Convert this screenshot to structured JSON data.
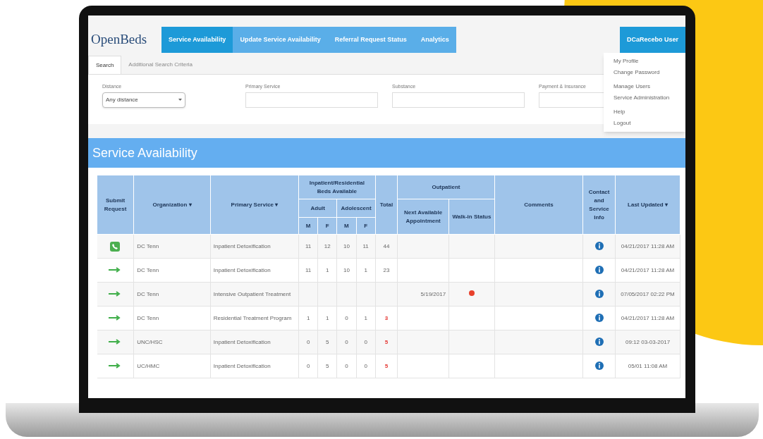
{
  "nav": {
    "logo": "OpenBeds",
    "tabs": [
      {
        "label": "Service Availability",
        "selected": true
      },
      {
        "label": "Update Service Availability",
        "selected": false
      },
      {
        "label": "Referral Request Status",
        "selected": false
      },
      {
        "label": "Analytics",
        "selected": false
      }
    ],
    "user": "DCaRecebo User"
  },
  "user_menu": {
    "groups": [
      [
        "My Profile",
        "Change Password"
      ],
      [
        "Manage Users",
        "Service Administration"
      ],
      [
        "Help",
        "Logout"
      ]
    ]
  },
  "search_tabs": [
    {
      "label": "Search",
      "selected": true
    },
    {
      "label": "Additional Search Criteria",
      "selected": false
    }
  ],
  "filters": [
    {
      "label": "Distance",
      "kind": "select",
      "value": "Any distance"
    },
    {
      "label": "Primary Service",
      "kind": "text"
    },
    {
      "label": "Substance",
      "kind": "text"
    },
    {
      "label": "Payment & Insurance",
      "kind": "text"
    }
  ],
  "section_title": "Service Availability",
  "table": {
    "headers": {
      "submit": "Submit Request",
      "organization": "Organization ▾",
      "service": "Primary Service ▾",
      "beds": "Inpatient/Residential Beds Available",
      "adult": "Adult",
      "adolescent": "Adolescent",
      "m": "M",
      "f": "F",
      "m2": "M",
      "f2": "F",
      "total": "Total",
      "outpatient": "Outpatient",
      "next": "Next Available Appointment",
      "walkin": "Walk-in Status",
      "comments": "Comments",
      "contact": "Contact and Service Info",
      "updated": "Last Updated ▾"
    },
    "rows": [
      {
        "kind": "phone",
        "organization": "DC Tenn",
        "service": "Inpatient Detoxification",
        "beds": [
          "11",
          "12",
          "10",
          "11"
        ],
        "total": "44",
        "total_alert": false,
        "next": "",
        "walkin": null,
        "updated": "04/21/2017 11:28 AM"
      },
      {
        "kind": "arrow",
        "organization": "DC Tenn",
        "service": "Inpatient Detoxification",
        "beds": [
          "11",
          "1",
          "10",
          "1"
        ],
        "total": "23",
        "total_alert": false,
        "next": "",
        "walkin": null,
        "updated": "04/21/2017 11:28 AM"
      },
      {
        "kind": "arrow",
        "organization": "DC Tenn",
        "service": "Intensive Outpatient Treatment",
        "beds": [],
        "total": "",
        "next": "5/19/2017",
        "walkin": {
          "color": "#e8412c"
        },
        "updated": "07/05/2017 02:22 PM"
      },
      {
        "kind": "arrow",
        "organization": "DC Tenn",
        "service": "Residential Treatment Program",
        "beds": [
          "1",
          "1",
          "0",
          "1"
        ],
        "total": "3",
        "total_alert": true,
        "next": "",
        "walkin": null,
        "updated": "04/21/2017 11:28 AM"
      },
      {
        "kind": "arrow",
        "organization": "UNC/HSC",
        "service": "Inpatient Detoxification",
        "beds": [
          "0",
          "5",
          "0",
          "0"
        ],
        "total": "5",
        "total_alert": true,
        "next": "",
        "walkin": null,
        "updated": "09:12 03-03-2017"
      },
      {
        "kind": "arrow",
        "organization": "UC/HMC",
        "service": "Inpatient Detoxification",
        "beds": [
          "0",
          "5",
          "0",
          "0"
        ],
        "total": "5",
        "total_alert": true,
        "next": "",
        "walkin": null,
        "updated": "05/01 11:08 AM"
      }
    ]
  }
}
